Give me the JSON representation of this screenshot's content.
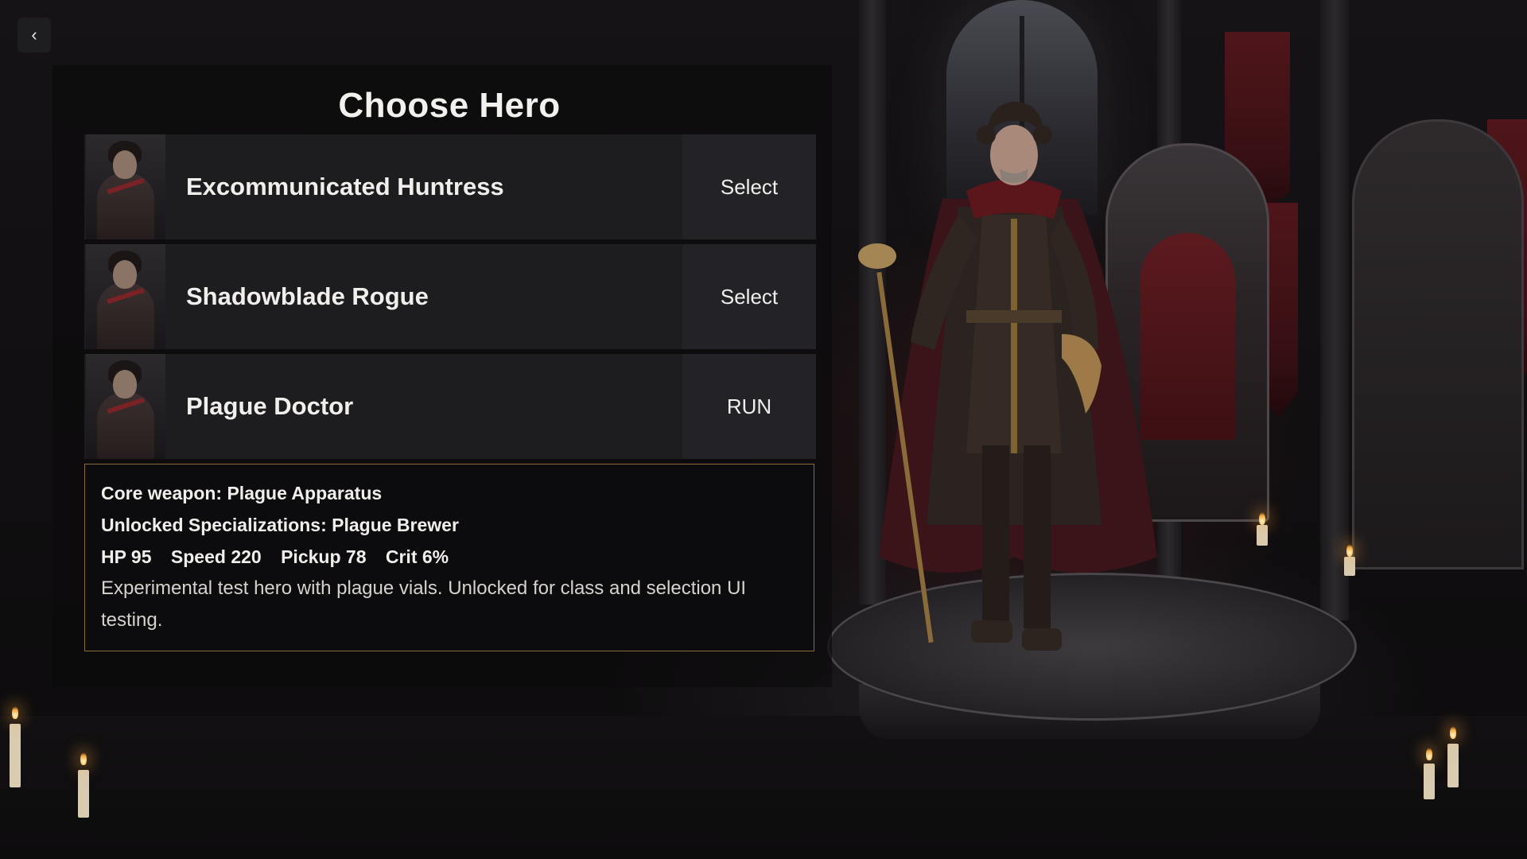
{
  "screen": {
    "title": "Choose Hero",
    "back_label": "‹"
  },
  "heroes": [
    {
      "name": "Excommunicated Huntress",
      "action": "Select"
    },
    {
      "name": "Shadowblade Rogue",
      "action": "Select"
    },
    {
      "name": "Plague Doctor",
      "action": "RUN"
    }
  ],
  "details": {
    "core_weapon": "Core weapon: Plague Apparatus",
    "specializations": "Unlocked Specializations: Plague Brewer",
    "stats": {
      "hp": "HP 95",
      "speed": "Speed 220",
      "pickup": "Pickup 78",
      "crit": "Crit 6%"
    },
    "description": "Experimental test hero with plague vials. Unlocked for class and selection UI testing."
  },
  "colors": {
    "panel_bg": "#1d1c1f",
    "details_border": "#8a6c3a",
    "text": "#f1efec",
    "banner_red": "#5a161b"
  }
}
